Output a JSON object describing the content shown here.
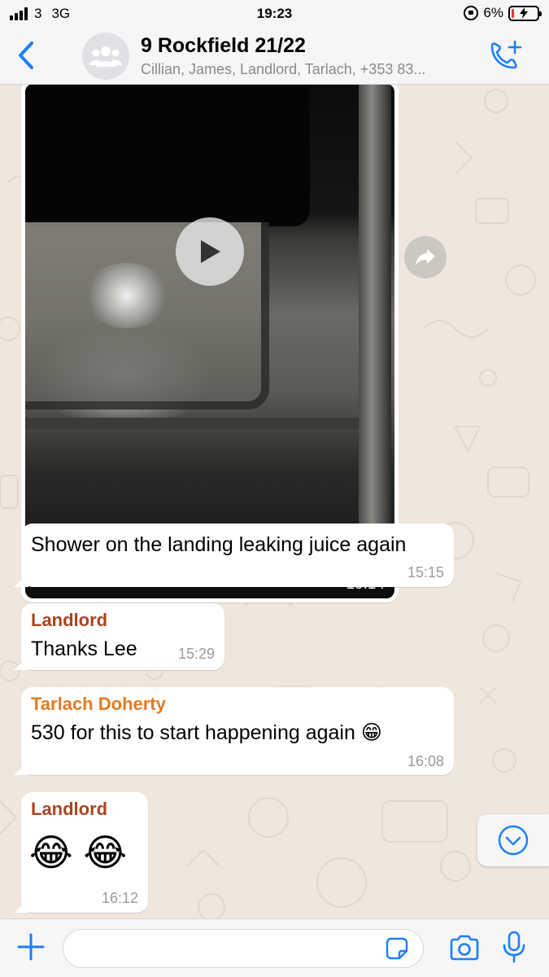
{
  "status_bar": {
    "carrier": "3",
    "network": "3G",
    "time": "19:23",
    "battery_percent": "6%"
  },
  "header": {
    "title": "9 Rockfield 21/22",
    "participants": "Cillian, James, Landlord, Tarlach, +353 83..."
  },
  "colors": {
    "accent": "#1b7ffe",
    "landlord": "#a94420",
    "tarlach": "#e27b23",
    "background": "#efe7dd",
    "bubble": "#ffffff",
    "battery_low": "#e03b3b"
  },
  "messages": [
    {
      "type": "video",
      "time": "15:14"
    },
    {
      "type": "text",
      "text": "Shower on the landing leaking juice again",
      "time": "15:15"
    },
    {
      "type": "text",
      "sender": "Landlord",
      "text": "Thanks Lee",
      "time": "15:29"
    },
    {
      "type": "text",
      "sender": "Tarlach Doherty",
      "text": "530 for this to start happening again 😁",
      "time": "16:08"
    },
    {
      "type": "text",
      "sender": "Landlord",
      "text": "😂 😂",
      "time": "16:12"
    }
  ],
  "input": {
    "placeholder": ""
  },
  "icons": {
    "back": "chevron-left-icon",
    "avatar": "group-icon",
    "call": "add-call-icon",
    "play": "play-icon",
    "forward": "forward-icon",
    "scroll_down": "chevron-down-icon",
    "attach": "plus-icon",
    "sticker": "sticker-icon",
    "camera": "camera-icon",
    "mic": "microphone-icon"
  }
}
